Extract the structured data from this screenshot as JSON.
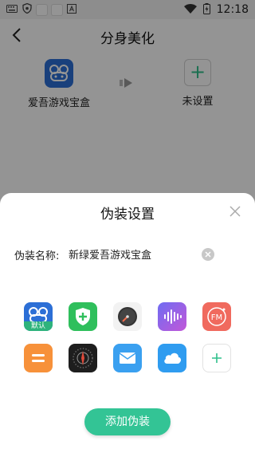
{
  "status_bar": {
    "time": "12:18"
  },
  "header": {
    "title": "分身美化"
  },
  "source_app": {
    "label": "爱吾游戏宝盒"
  },
  "target_app": {
    "label": "未设置"
  },
  "sheet": {
    "title": "伪装设置",
    "name_label": "伪装名称:",
    "name_value": "新绿爱吾游戏宝盒",
    "default_badge": "默认",
    "add_button_label": "添加伪装"
  },
  "icons": [
    {
      "name": "aiwu-gamebox-icon",
      "color": "#2c6fd6"
    },
    {
      "name": "shield-plus-icon",
      "color": "#2fbf5c"
    },
    {
      "name": "clock-gauge-icon",
      "color": "#3a3a3a"
    },
    {
      "name": "sound-wave-icon",
      "color": "#8a5cf0"
    },
    {
      "name": "fm-radio-icon",
      "color": "#f06a5e"
    },
    {
      "name": "notes-icon",
      "color": "#f7913a"
    },
    {
      "name": "compass-icon",
      "color": "#1e1e1e"
    },
    {
      "name": "mail-icon",
      "color": "#3aa0f0"
    },
    {
      "name": "cloud-icon",
      "color": "#2f9cf0"
    },
    {
      "name": "add-icon",
      "color": "#2fc08b"
    }
  ]
}
